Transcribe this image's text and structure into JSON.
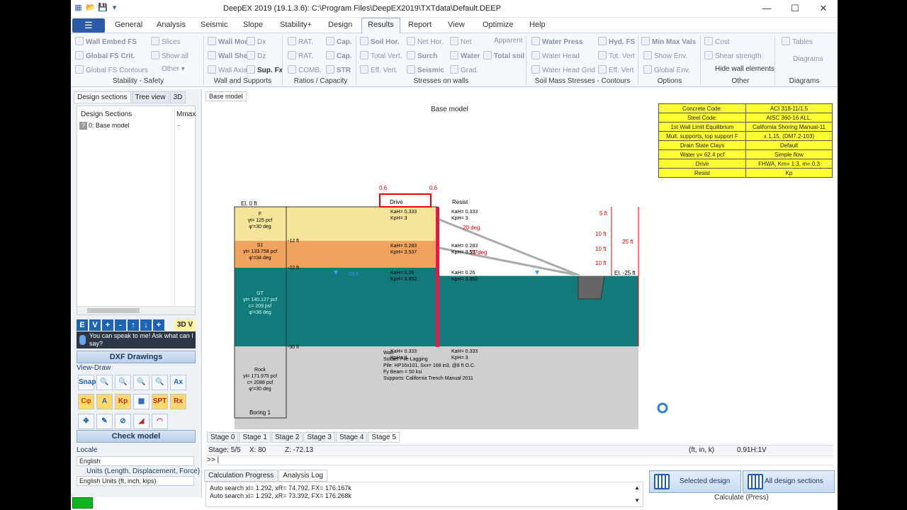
{
  "window": {
    "title": "DeepEX 2019  (19.1.3.6): C:\\Program Files\\DeepEX2019\\TXTdata\\Default.DEEP",
    "controls": [
      "—",
      "☐",
      "✕"
    ]
  },
  "menu": {
    "items": [
      "General",
      "Analysis",
      "Seismic",
      "Slope",
      "Stability+",
      "Design",
      "Results",
      "Report",
      "View",
      "Optimize",
      "Help"
    ],
    "active": "Results"
  },
  "ribbon": {
    "stability": {
      "embed": "Wall Embed FS",
      "slices": "Slices",
      "globalfs": "Global FS Crit.",
      "showall": "Show all",
      "contours": "Global FS Contours",
      "other": "Other",
      "group": "Stability - Safety"
    },
    "wall": {
      "mom": "Wall Mom.",
      "dx": "Dx",
      "shear": "Wall Shear",
      "dz": "Dz",
      "axial": "Wall Axial",
      "supfx": "Sup. Fx",
      "group": "Wall and Supports"
    },
    "ratios": {
      "rat1": "RAT.",
      "cap1": "Cap.",
      "rat2": "RAT.",
      "cap2": "Cap.",
      "comb": "COMB.",
      "str": "STR",
      "group": "Ratios / Capacity"
    },
    "stresses": {
      "soilhor": "Soil Hor.",
      "nethor": "Net Hor.",
      "net": "Net",
      "apparent": "Apparent",
      "totalvert": "Total Vert.",
      "surch": "Surch",
      "water": "Water",
      "totalsoil": "Total soil",
      "effvert": "Eff. Vert.",
      "seismic": "Seismic",
      "grad": "Grad.",
      "group": "Stresses on walls"
    },
    "mass": {
      "wpress": "Water Press",
      "hydfs": "Hyd. FS",
      "whead": "Water Head",
      "totvert": "Tot. Vert",
      "wgrid": "Water Head Grid",
      "effvert": "Eff. Vert",
      "group": "Soil Mass Stresses - Contours"
    },
    "options": {
      "minmax": "Min Max Vals",
      "showenv": "Show Env.",
      "globalenv": "Global Env.",
      "group": "Options"
    },
    "other": {
      "cost": "Cost",
      "shear": "Shear strength",
      "hide": "Hide wall elements",
      "group": "Other"
    },
    "diagrams": {
      "tables": "Tables",
      "diagrams": "Diagrams",
      "group": "Diagrams"
    }
  },
  "left": {
    "tabs": [
      "Design sections",
      "Tree view",
      "3D"
    ],
    "col1": "Design Sections",
    "col2": "Mmax",
    "row": "0: Base model",
    "rowval": "-",
    "tools": [
      "E",
      "V",
      "+",
      "-",
      "↑",
      "↓",
      "+"
    ],
    "btn3d": "3D V",
    "speak": "You can speak to me! Ask what can I say?",
    "dxf": "DXF Drawings",
    "viewdraw": "View-Draw",
    "tools1": [
      "Snap",
      "🔍",
      "🔍",
      "🔍",
      "🔍",
      "Ax"
    ],
    "tools2": [
      "Cφ",
      "A",
      "Kp",
      "▦",
      "SPT",
      "Rx"
    ],
    "check": "Check model",
    "locale": "Locale",
    "locale_val": "English",
    "units_lbl": "Units (Length, Displacement, Force)",
    "units_val": "English Units (ft, inch, kips)"
  },
  "canvas": {
    "tab": "Base model",
    "title": "Base model",
    "info": [
      [
        "Concrete Code:",
        "ACI 318-11/1.5"
      ],
      [
        "Steel Code:",
        "AISC 360-16 ALL."
      ],
      [
        "1st Wall Limit Equilibrium",
        "California Shoring Manual-11"
      ],
      [
        "Mult. supports, top support F",
        "x 1.15, (DM7.2-103)"
      ],
      [
        "Drain State Clays",
        "Default"
      ],
      [
        "Water γ= 62.4 pcf",
        "Simple flow"
      ],
      [
        "Drive",
        "FHWA, Km= 1.3, m= 0.3"
      ],
      [
        "Resist",
        "Kp"
      ]
    ],
    "drive": "Drive",
    "resist": "Resist",
    "v06a": "0.6",
    "v06b": "0.6",
    "el0": "El. 0 ft",
    "el25": "El. -25 ft",
    "d12": "-12 ft",
    "d22": "-22 ft",
    "d30": "-30 ft",
    "w25": "-25 ft",
    "layers": {
      "F": [
        "F",
        "γt= 125 pcf",
        "φ'=30 deg"
      ],
      "S1": [
        "S1",
        "γt= 133.758 pcf",
        "φ'=34 deg"
      ],
      "GT": [
        "GT",
        "γt= 140.127 pcf",
        "c= 209 psf",
        "φ'=36 deg"
      ],
      "Rock": [
        "Rock",
        "γt= 171.975 pcf",
        "c= 2088 psf",
        "φ'=30 deg"
      ]
    },
    "boring": "Boring 1",
    "k1": [
      "KaH= 0.333",
      "KpH= 3"
    ],
    "k2": [
      "KaH= 0.283",
      "KpH= 3.537"
    ],
    "k3": [
      "KaH= 0.26",
      "KpH= 3.852"
    ],
    "k4": [
      "KaH= 0.333",
      "KpH= 3"
    ],
    "kr1": [
      "KaH= 0.333",
      "KpH= 3"
    ],
    "kr2": [
      "KaH= 0.283",
      "KpH= 3.537"
    ],
    "kr3": [
      "KaH= 0.26",
      "KpH= 3.852"
    ],
    "kr4": [
      "KaH= 0.333",
      "KpH= 3"
    ],
    "deg20": "20 deg",
    "deg21": "21 deg",
    "wallinfo": [
      "Wall:",
      "Soldier Pile-Lagging",
      "Pile: HP16x101, Sxx= 168 in3, @8 ft O.C.",
      "Fy Beam = 50 ksi",
      "Supports: California Trench Manual 2011"
    ],
    "dims": [
      "5 ft",
      "10 ft",
      "10 ft",
      "10 ft",
      "25 ft"
    ]
  },
  "stages": [
    "Stage 0",
    "Stage 1",
    "Stage 2",
    "Stage 3",
    "Stage 4",
    "Stage 5"
  ],
  "status": {
    "stage": "Stage: 5/5",
    "x": "X: 80",
    "z": "Z: -72.13",
    "units": "(ft, in, k)",
    "scale": "0.91H:1V"
  },
  "cmd": ">> |",
  "log": {
    "tabs": [
      "Calculation Progress",
      "Analysis Log"
    ],
    "lines": [
      "Auto search xl= 1.292, xR= 74.792, FX= 176.167k",
      "Auto search xl= 1.292, xR= 73.392, FX= 176.268k"
    ]
  },
  "calc": {
    "selected": "Selected design",
    "all": "All design sections",
    "label": "Calculate (Press)"
  },
  "colors": {
    "accent": "#1f5fb0",
    "sand": "#f5e49a",
    "clay": "#f0a35f",
    "water": "#127a7a",
    "rock": "#cfcfcf",
    "wall": "#e8174a",
    "info": "#ffff33"
  }
}
